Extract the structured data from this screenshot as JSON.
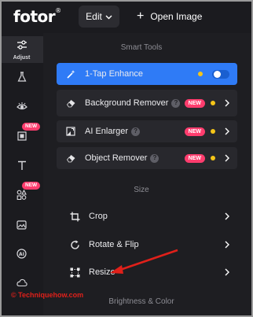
{
  "topbar": {
    "logo": "fotor",
    "logo_mark": "®",
    "edit_label": "Edit",
    "open_label": "Open Image"
  },
  "rail": {
    "adjust_label": "Adjust",
    "new_badge": "NEW"
  },
  "panel": {
    "smart_tools_title": "Smart Tools",
    "size_title": "Size",
    "brightness_title": "Brightness & Color",
    "smart_tools": [
      {
        "label": "1-Tap Enhance"
      },
      {
        "label": "Background Remover",
        "badge": "NEW"
      },
      {
        "label": "AI Enlarger",
        "badge": "NEW"
      },
      {
        "label": "Object Remover",
        "badge": "NEW"
      }
    ],
    "size_tools": [
      {
        "label": "Crop"
      },
      {
        "label": "Rotate & Flip"
      },
      {
        "label": "Resize"
      }
    ]
  },
  "watermark": "© Techniquehow.com",
  "colors": {
    "accent": "#2f7bf6",
    "new_badge": "#ff3d6e",
    "dot": "#f5c518",
    "annotation": "#e0201a"
  }
}
